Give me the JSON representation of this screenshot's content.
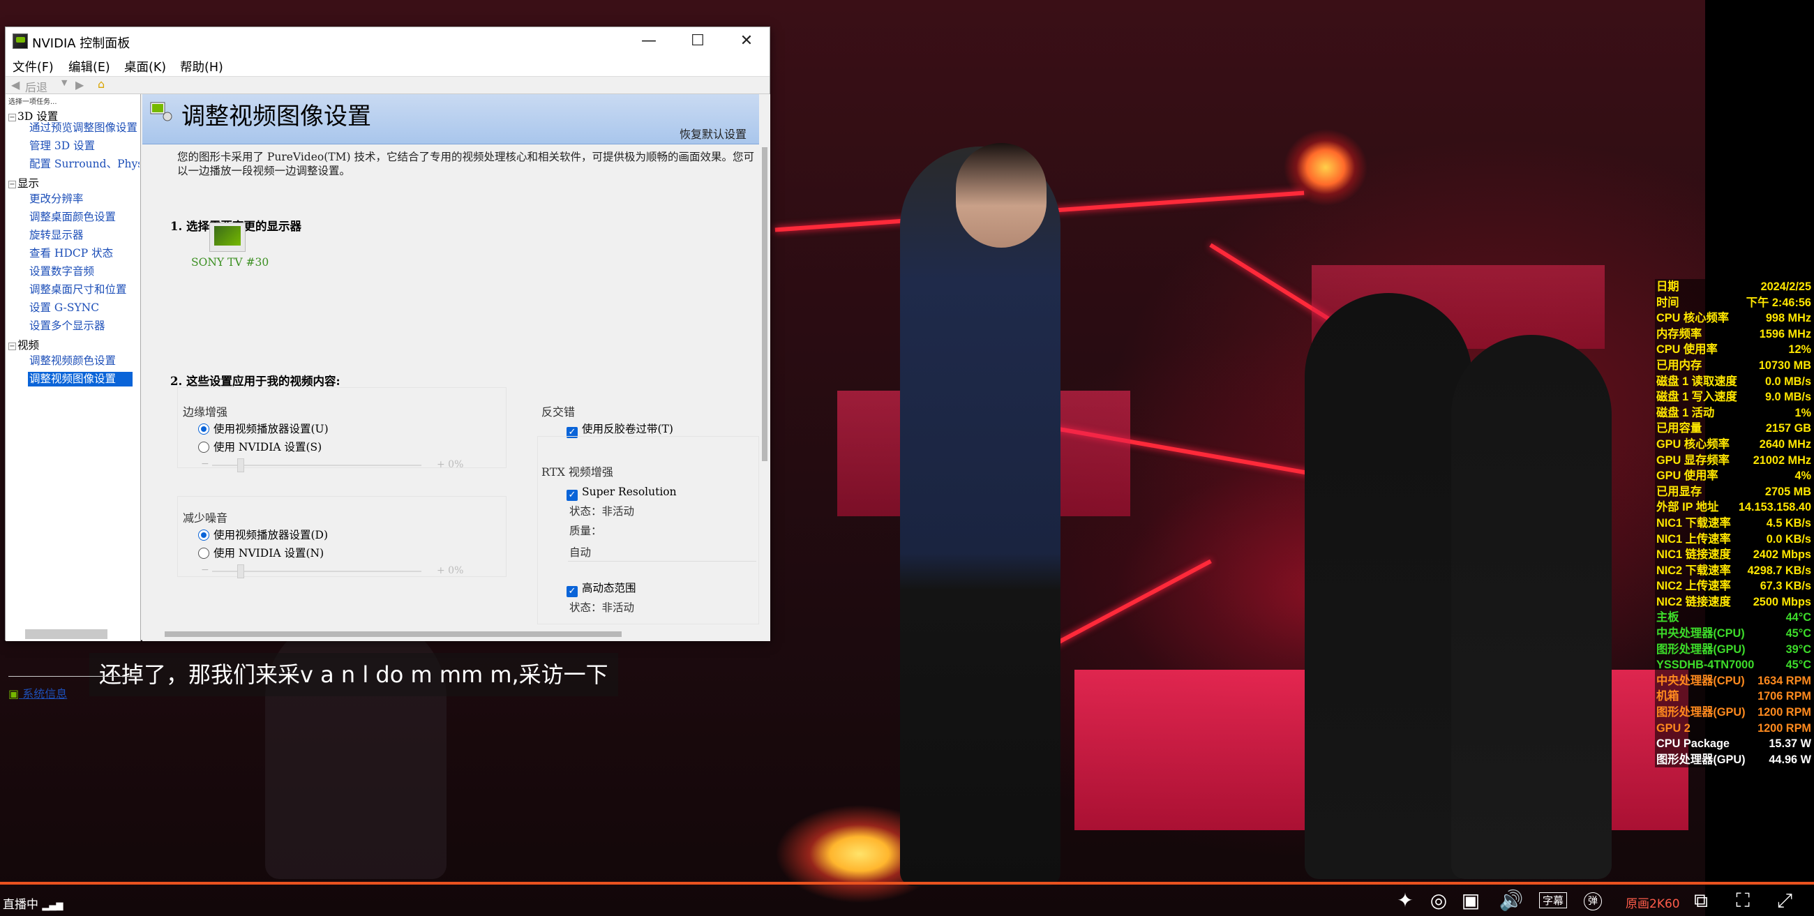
{
  "window": {
    "title": "NVIDIA 控制面板",
    "menu": [
      "文件(F)",
      "编辑(E)",
      "桌面(K)",
      "帮助(H)"
    ],
    "toolbar_back": "后退",
    "task_hint": "选择一项任务..."
  },
  "sidebar": {
    "categories": [
      {
        "label": "3D 设置",
        "items": [
          "通过预览调整图像设置",
          "管理 3D 设置",
          "配置 Surround、PhysX"
        ]
      },
      {
        "label": "显示",
        "items": [
          "更改分辨率",
          "调整桌面颜色设置",
          "旋转显示器",
          "查看 HDCP 状态",
          "设置数字音频",
          "调整桌面尺寸和位置",
          "设置 G-SYNC",
          "设置多个显示器"
        ]
      },
      {
        "label": "视频",
        "items": [
          "调整视频颜色设置",
          "调整视频图像设置"
        ]
      }
    ],
    "selected": "调整视频图像设置",
    "system_info": "系统信息"
  },
  "page": {
    "title": "调整视频图像设置",
    "restore_defaults": "恢复默认设置",
    "description": "您的图形卡采用了 PureVideo(TM) 技术，它结合了专用的视频处理核心和相关软件，可提供极为顺畅的画面效果。您可以一边播放一段视频一边调整设置。",
    "step1": "1.  选择需要变更的显示器",
    "display_name": "SONY TV  #30",
    "step2": "2.  这些设置应用于我的视频内容:",
    "edge": {
      "label": "边缘增强",
      "opt1": "使用视频播放器设置(U)",
      "opt2": "使用 NVIDIA 设置(S)",
      "slider_value": "+ 0%"
    },
    "noise": {
      "label": "减少噪音",
      "opt1": "使用视频播放器设置(D)",
      "opt2": "使用 NVIDIA 设置(N)",
      "slider_value": "+ 0%"
    },
    "deinterlace": {
      "label": "反交错",
      "option": "使用反胶卷过带(T)"
    },
    "rtx": {
      "label": "RTX 视频增强",
      "super_resolution": "Super Resolution",
      "status1": "状态：非活动",
      "quality_label": "质量：",
      "quality_value": "自动",
      "hdr": "高动态范围",
      "status2": "状态：非活动"
    }
  },
  "subtitle": "还掉了，那我们来采v a n l do m mm m,采访一下",
  "player": {
    "live": "直播中",
    "subtitle_btn": "字幕",
    "danmaku_btn": "弹",
    "quality": "原画2K60",
    "progress_color": "#e8521f"
  },
  "osd": [
    {
      "k": "日期",
      "v": "2024/2/25",
      "c": "#ffe600"
    },
    {
      "k": "时间",
      "v": "下午 2:46:56",
      "c": "#ffe600"
    },
    {
      "k": "CPU 核心频率",
      "v": "998 MHz",
      "c": "#ffe600"
    },
    {
      "k": "内存频率",
      "v": "1596 MHz",
      "c": "#ffe600"
    },
    {
      "k": "CPU 使用率",
      "v": "12%",
      "c": "#ffe600"
    },
    {
      "k": "已用内存",
      "v": "10730 MB",
      "c": "#ffe600"
    },
    {
      "k": "磁盘 1 读取速度",
      "v": "0.0 MB/s",
      "c": "#ffe600"
    },
    {
      "k": "磁盘 1 写入速度",
      "v": "9.0 MB/s",
      "c": "#ffe600"
    },
    {
      "k": "磁盘 1 活动",
      "v": "1%",
      "c": "#ffe600"
    },
    {
      "k": "已用容量",
      "v": "2157 GB",
      "c": "#ffe600"
    },
    {
      "k": "GPU 核心频率",
      "v": "2640 MHz",
      "c": "#ffe600"
    },
    {
      "k": "GPU 显存频率",
      "v": "21002 MHz",
      "c": "#ffe600"
    },
    {
      "k": "GPU 使用率",
      "v": "4%",
      "c": "#ffe600"
    },
    {
      "k": "已用显存",
      "v": "2705 MB",
      "c": "#ffe600"
    },
    {
      "k": "外部 IP 地址",
      "v": "14.153.158.40",
      "c": "#ffe600"
    },
    {
      "k": "NIC1 下载速率",
      "v": "4.5 KB/s",
      "c": "#ffe600"
    },
    {
      "k": "NIC1 上传速率",
      "v": "0.0 KB/s",
      "c": "#ffe600"
    },
    {
      "k": "NIC1 链接速度",
      "v": "2402 Mbps",
      "c": "#ffe600"
    },
    {
      "k": "NIC2 下载速率",
      "v": "4298.7 KB/s",
      "c": "#ffe600"
    },
    {
      "k": "NIC2 上传速率",
      "v": "67.3 KB/s",
      "c": "#ffe600"
    },
    {
      "k": "NIC2 链接速度",
      "v": "2500 Mbps",
      "c": "#ffe600"
    },
    {
      "k": "主板",
      "v": "44°C",
      "c": "#3ddc2a"
    },
    {
      "k": "中央处理器(CPU)",
      "v": "45°C",
      "c": "#3ddc2a"
    },
    {
      "k": "图形处理器(GPU)",
      "v": "39°C",
      "c": "#3ddc2a"
    },
    {
      "k": "YSSDHB-4TN7000",
      "v": "45°C",
      "c": "#3ddc2a"
    },
    {
      "k": "中央处理器(CPU)",
      "v": "1634 RPM",
      "c": "#ff8a1e"
    },
    {
      "k": "机箱",
      "v": "1706 RPM",
      "c": "#ff8a1e"
    },
    {
      "k": "图形处理器(GPU)",
      "v": "1200 RPM",
      "c": "#ff8a1e"
    },
    {
      "k": "GPU 2",
      "v": "1200 RPM",
      "c": "#ff8a1e"
    },
    {
      "k": "CPU Package",
      "v": "15.37 W",
      "c": "#ffffff"
    },
    {
      "k": "图形处理器(GPU)",
      "v": "44.96 W",
      "c": "#ffffff"
    }
  ]
}
